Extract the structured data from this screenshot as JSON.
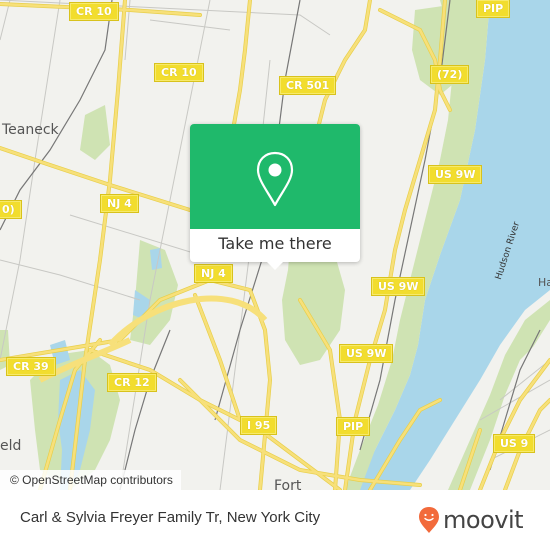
{
  "map": {
    "place_labels": [
      {
        "id": "teaneck",
        "text": "Teaneck"
      },
      {
        "id": "ridgefield",
        "text": "eld"
      },
      {
        "id": "fort",
        "text": "Fort"
      },
      {
        "id": "ha",
        "text": "Ha"
      }
    ],
    "water_labels": [
      {
        "id": "hudson-river",
        "text": "Hudson River"
      }
    ],
    "road_shields": [
      {
        "id": "cr10-top",
        "text": "CR 10"
      },
      {
        "id": "cr10-mid",
        "text": "CR 10"
      },
      {
        "id": "cr501",
        "text": "CR 501"
      },
      {
        "id": "pip-top",
        "text": "PIP"
      },
      {
        "id": "route72",
        "text": "(72)"
      },
      {
        "id": "us9w-1",
        "text": "US 9W"
      },
      {
        "id": "nj4-1",
        "text": "NJ 4"
      },
      {
        "id": "cr10-left",
        "text": "0)"
      },
      {
        "id": "nj4-2",
        "text": "NJ 4"
      },
      {
        "id": "us9w-2",
        "text": "US 9W"
      },
      {
        "id": "us9w-3",
        "text": "US 9W"
      },
      {
        "id": "cr39",
        "text": "CR 39"
      },
      {
        "id": "cr12",
        "text": "CR 12"
      },
      {
        "id": "i95",
        "text": "I 95"
      },
      {
        "id": "pip-bottom",
        "text": "PIP"
      },
      {
        "id": "us9",
        "text": "US 9"
      }
    ],
    "attribution": "© OpenStreetMap contributors",
    "colors": {
      "land": "#f2f2ee",
      "water": "#a9d6ea",
      "park": "#cfe3b3",
      "road": "#f7e07a",
      "shield": "#f2dd2e"
    }
  },
  "popup": {
    "icon": "map-pin-icon",
    "action_label": "Take me there",
    "color": "#1fb96b"
  },
  "footer": {
    "title": "Carl & Sylvia Freyer Family Tr, New York City",
    "brand": "moovit",
    "brand_color": "#f26a3b"
  }
}
